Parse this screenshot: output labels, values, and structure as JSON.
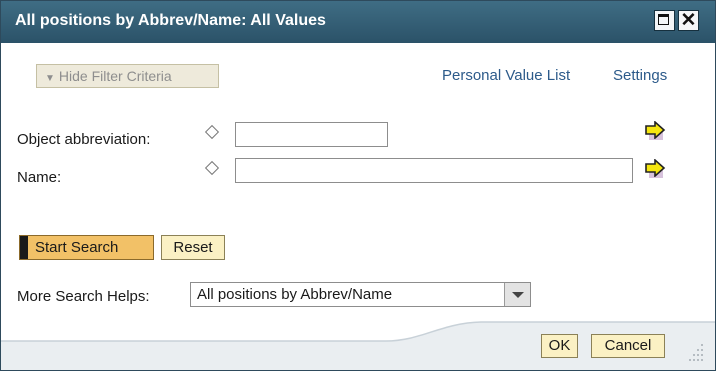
{
  "dialog": {
    "title": "All positions by Abbrev/Name: All Values"
  },
  "filter": {
    "hide_label": "Hide Filter Criteria"
  },
  "links": {
    "personal_value_list": "Personal Value List",
    "settings": "Settings"
  },
  "fields": [
    {
      "label": "Object abbreviation:",
      "value": ""
    },
    {
      "label": "Name:",
      "value": ""
    }
  ],
  "actions": {
    "start_search": "Start Search",
    "reset": "Reset"
  },
  "more_search_helps": {
    "label": "More Search Helps:",
    "selected": "All positions by Abbrev/Name"
  },
  "footer": {
    "ok": "OK",
    "cancel": "Cancel"
  },
  "colors": {
    "titlebar": "#2b5268",
    "primary_button": "#f2c167",
    "button": "#fbf1c4",
    "link": "#2c5a8a"
  }
}
